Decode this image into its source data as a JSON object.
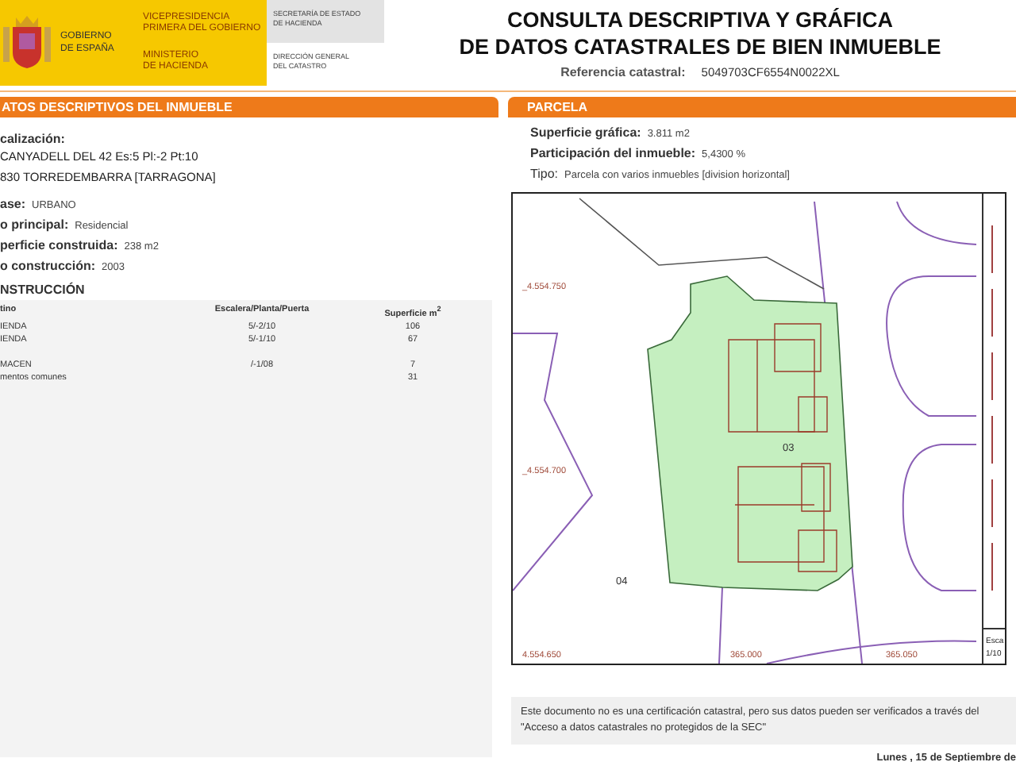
{
  "header": {
    "government": {
      "name_lines": [
        "GOBIERNO",
        "DE ESPAÑA"
      ]
    },
    "ministry_lines": [
      [
        "VICEPRESIDENCIA",
        "PRIMERA DEL GOBIERNO"
      ],
      [
        "MINISTERIO",
        "DE HACIENDA"
      ]
    ],
    "department_lines": [
      [
        "SECRETARÍA DE ESTADO",
        "DE HACIENDA"
      ],
      [
        "DIRECCIÓN GENERAL",
        "DEL CATASTRO"
      ]
    ],
    "title_lines": [
      "CONSULTA DESCRIPTIVA Y GRÁFICA",
      "DE DATOS CATASTRALES DE BIEN INMUEBLE"
    ],
    "reference": {
      "label": "Referencia catastral:",
      "value": "5049703CF6554N0022XL"
    }
  },
  "property": {
    "section_title": "ATOS DESCRIPTIVOS DEL INMUEBLE",
    "location_label": "calización:",
    "address_lines": [
      "CANYADELL DEL 42 Es:5 Pl:-2 Pt:10",
      "830 TORREDEMBARRA [TARRAGONA]"
    ],
    "fields": [
      {
        "label": "ase:",
        "value": "URBANO"
      },
      {
        "label": "o principal:",
        "value": "Residencial"
      },
      {
        "label": "perficie construida:",
        "value": "238 m2"
      },
      {
        "label": "o construcción:",
        "value": "2003"
      }
    ],
    "construction": {
      "title": "NSTRUCCIÓN",
      "columns": [
        "tino",
        "Escalera/Planta/Puerta",
        "Superficie m$^{2}$"
      ],
      "rows": [
        [
          "IENDA",
          "5/-2/10",
          "106"
        ],
        [
          "IENDA",
          "5/-1/10",
          "67"
        ],
        [
          "MACEN",
          "/-1/08",
          "7"
        ],
        [
          "mentos comunes",
          "",
          "31"
        ]
      ]
    }
  },
  "parcel": {
    "section_title": "PARCELA",
    "fields": [
      {
        "label": "Superficie gráfica:",
        "value": "3.811 m2"
      },
      {
        "label": "Participación del inmueble:",
        "value": "5,4300 %"
      },
      {
        "label": "Tipo:",
        "value": "Parcela con varios inmuebles [division horizontal]"
      }
    ],
    "map": {
      "labels": [
        "_4.554.750",
        "_4.554.700",
        "4.554.650",
        "365.000",
        "365.050",
        "03",
        "04"
      ],
      "scale_lines": [
        "Esca",
        "1/10"
      ]
    }
  },
  "disclaimer": "Este documento no es una certificación catastral, pero sus datos pueden ser verificados a través del \"Acceso a datos catastrales no protegidos de la SEC\"",
  "date": "Lunes , 15 de Septiembre de"
}
